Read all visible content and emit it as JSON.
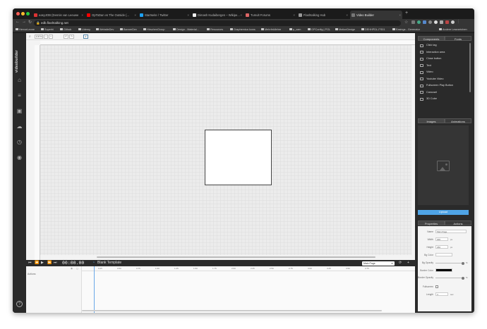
{
  "browser": {
    "tabs": [
      {
        "label": "easyJOB (Dennis van Leeuwe"
      },
      {
        "label": "OpToDan vs The Outside (..."
      },
      {
        "label": "Startseite / Twitter"
      },
      {
        "label": "Dimash Kudaibergen – Wikipe..."
      },
      {
        "label": "Tumult Forums"
      },
      {
        "label": "Flashtalking Hub"
      },
      {
        "label": "Video Builder"
      }
    ],
    "url": "edb.flashtalking.net",
    "bookmarks": [
      "HervorLeone",
      "Superhi",
      "Github",
      "Udemy",
      "WebsiteDev",
      "BannerDev",
      "HirschenGroup",
      "Design - Material...",
      "Resources",
      "Graphemica Icons",
      "Mehrfeldlehre",
      "p_cam",
      "GPConfig | PGL",
      "MotionDesign",
      "DEHHPDL-FS01",
      "Easings - Generator",
      "Andere Lesezeichen"
    ]
  },
  "sidebar": {
    "brand": "videobuilder",
    "help": "?"
  },
  "toolbar": {
    "zoom": "100%",
    "zoom_minus": "−",
    "zoom_plus": "+"
  },
  "timeline": {
    "timecode": "00:00.00",
    "template_name": "Blank Template",
    "page_select": "Main Page",
    "track_label": "Actions",
    "ticks": [
      "0:00",
      "0:25",
      "0:50",
      "0:75",
      "1:00",
      "1:25",
      "1:50",
      "1:75",
      "2:00",
      "2:25",
      "2:50",
      "2:75",
      "3:00",
      "3:25",
      "3:50",
      "3:75"
    ]
  },
  "right_panel": {
    "tabs_top": [
      "Components",
      "Fonts"
    ],
    "components": [
      "Click tag",
      "Interaction area",
      "Close button",
      "Text",
      "Video",
      "Youtube Video",
      "Fullscreen Play Button",
      "Carousel",
      "3D Cube"
    ],
    "tabs_mid": [
      "Images",
      "Animations"
    ],
    "upload_label": "Upload",
    "tabs_bottom": [
      "Properties",
      "Actions"
    ],
    "properties": {
      "name_label": "Name",
      "name_value": "Main Page",
      "width_label": "Width",
      "width_value": "300",
      "width_unit": "px",
      "height_label": "Height",
      "height_value": "250",
      "height_unit": "px",
      "bgcolor_label": "Bg Color",
      "bgopacity_label": "Bg Opacity",
      "bgopacity_unit": "%",
      "bordercolor_label": "Border Color",
      "borderopacity_label": "Border Opacity",
      "borderopacity_unit": "%",
      "fullscreen_label": "Fullscreen",
      "length_label": "Length",
      "length_value": "4",
      "length_unit": "sec"
    }
  }
}
